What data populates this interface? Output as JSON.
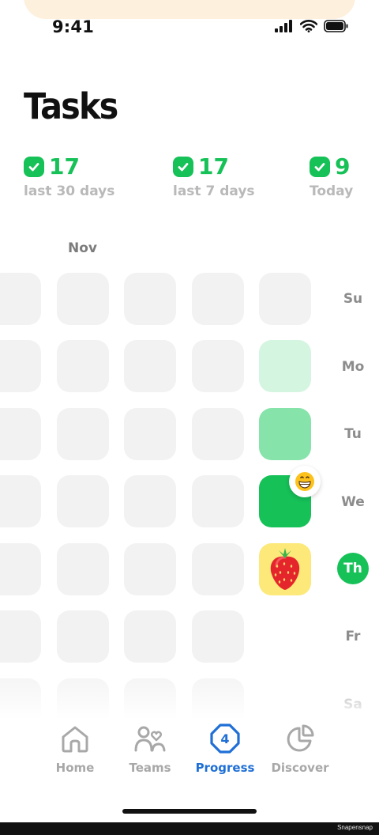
{
  "status_bar": {
    "time": "9:41"
  },
  "title": "Tasks",
  "stats": [
    {
      "value": "17",
      "label": "last 30 days"
    },
    {
      "value": "17",
      "label": "last 7 days"
    },
    {
      "value": "9",
      "label": "Today"
    }
  ],
  "calendar": {
    "month": "Nov",
    "days": [
      "Su",
      "Mo",
      "Tu",
      "We",
      "Th",
      "Fr",
      "Sa"
    ],
    "today": "Th",
    "current_week_colors": [
      "#f2f2f2",
      "#d4f5e0",
      "#86e3aa",
      "#16c158",
      "#fce97a"
    ]
  },
  "tabs": [
    {
      "label": "Home",
      "icon": "home-icon"
    },
    {
      "label": "Teams",
      "icon": "teams-icon"
    },
    {
      "label": "Progress",
      "icon": "progress-icon",
      "badge": "4",
      "active": true
    },
    {
      "label": "Discover",
      "icon": "discover-icon"
    }
  ],
  "footer": {
    "watermark": "Snapensnap"
  },
  "colors": {
    "accent_green": "#16c158",
    "active_blue": "#1f6fd6",
    "inactive_gray": "#a8a8a8"
  }
}
